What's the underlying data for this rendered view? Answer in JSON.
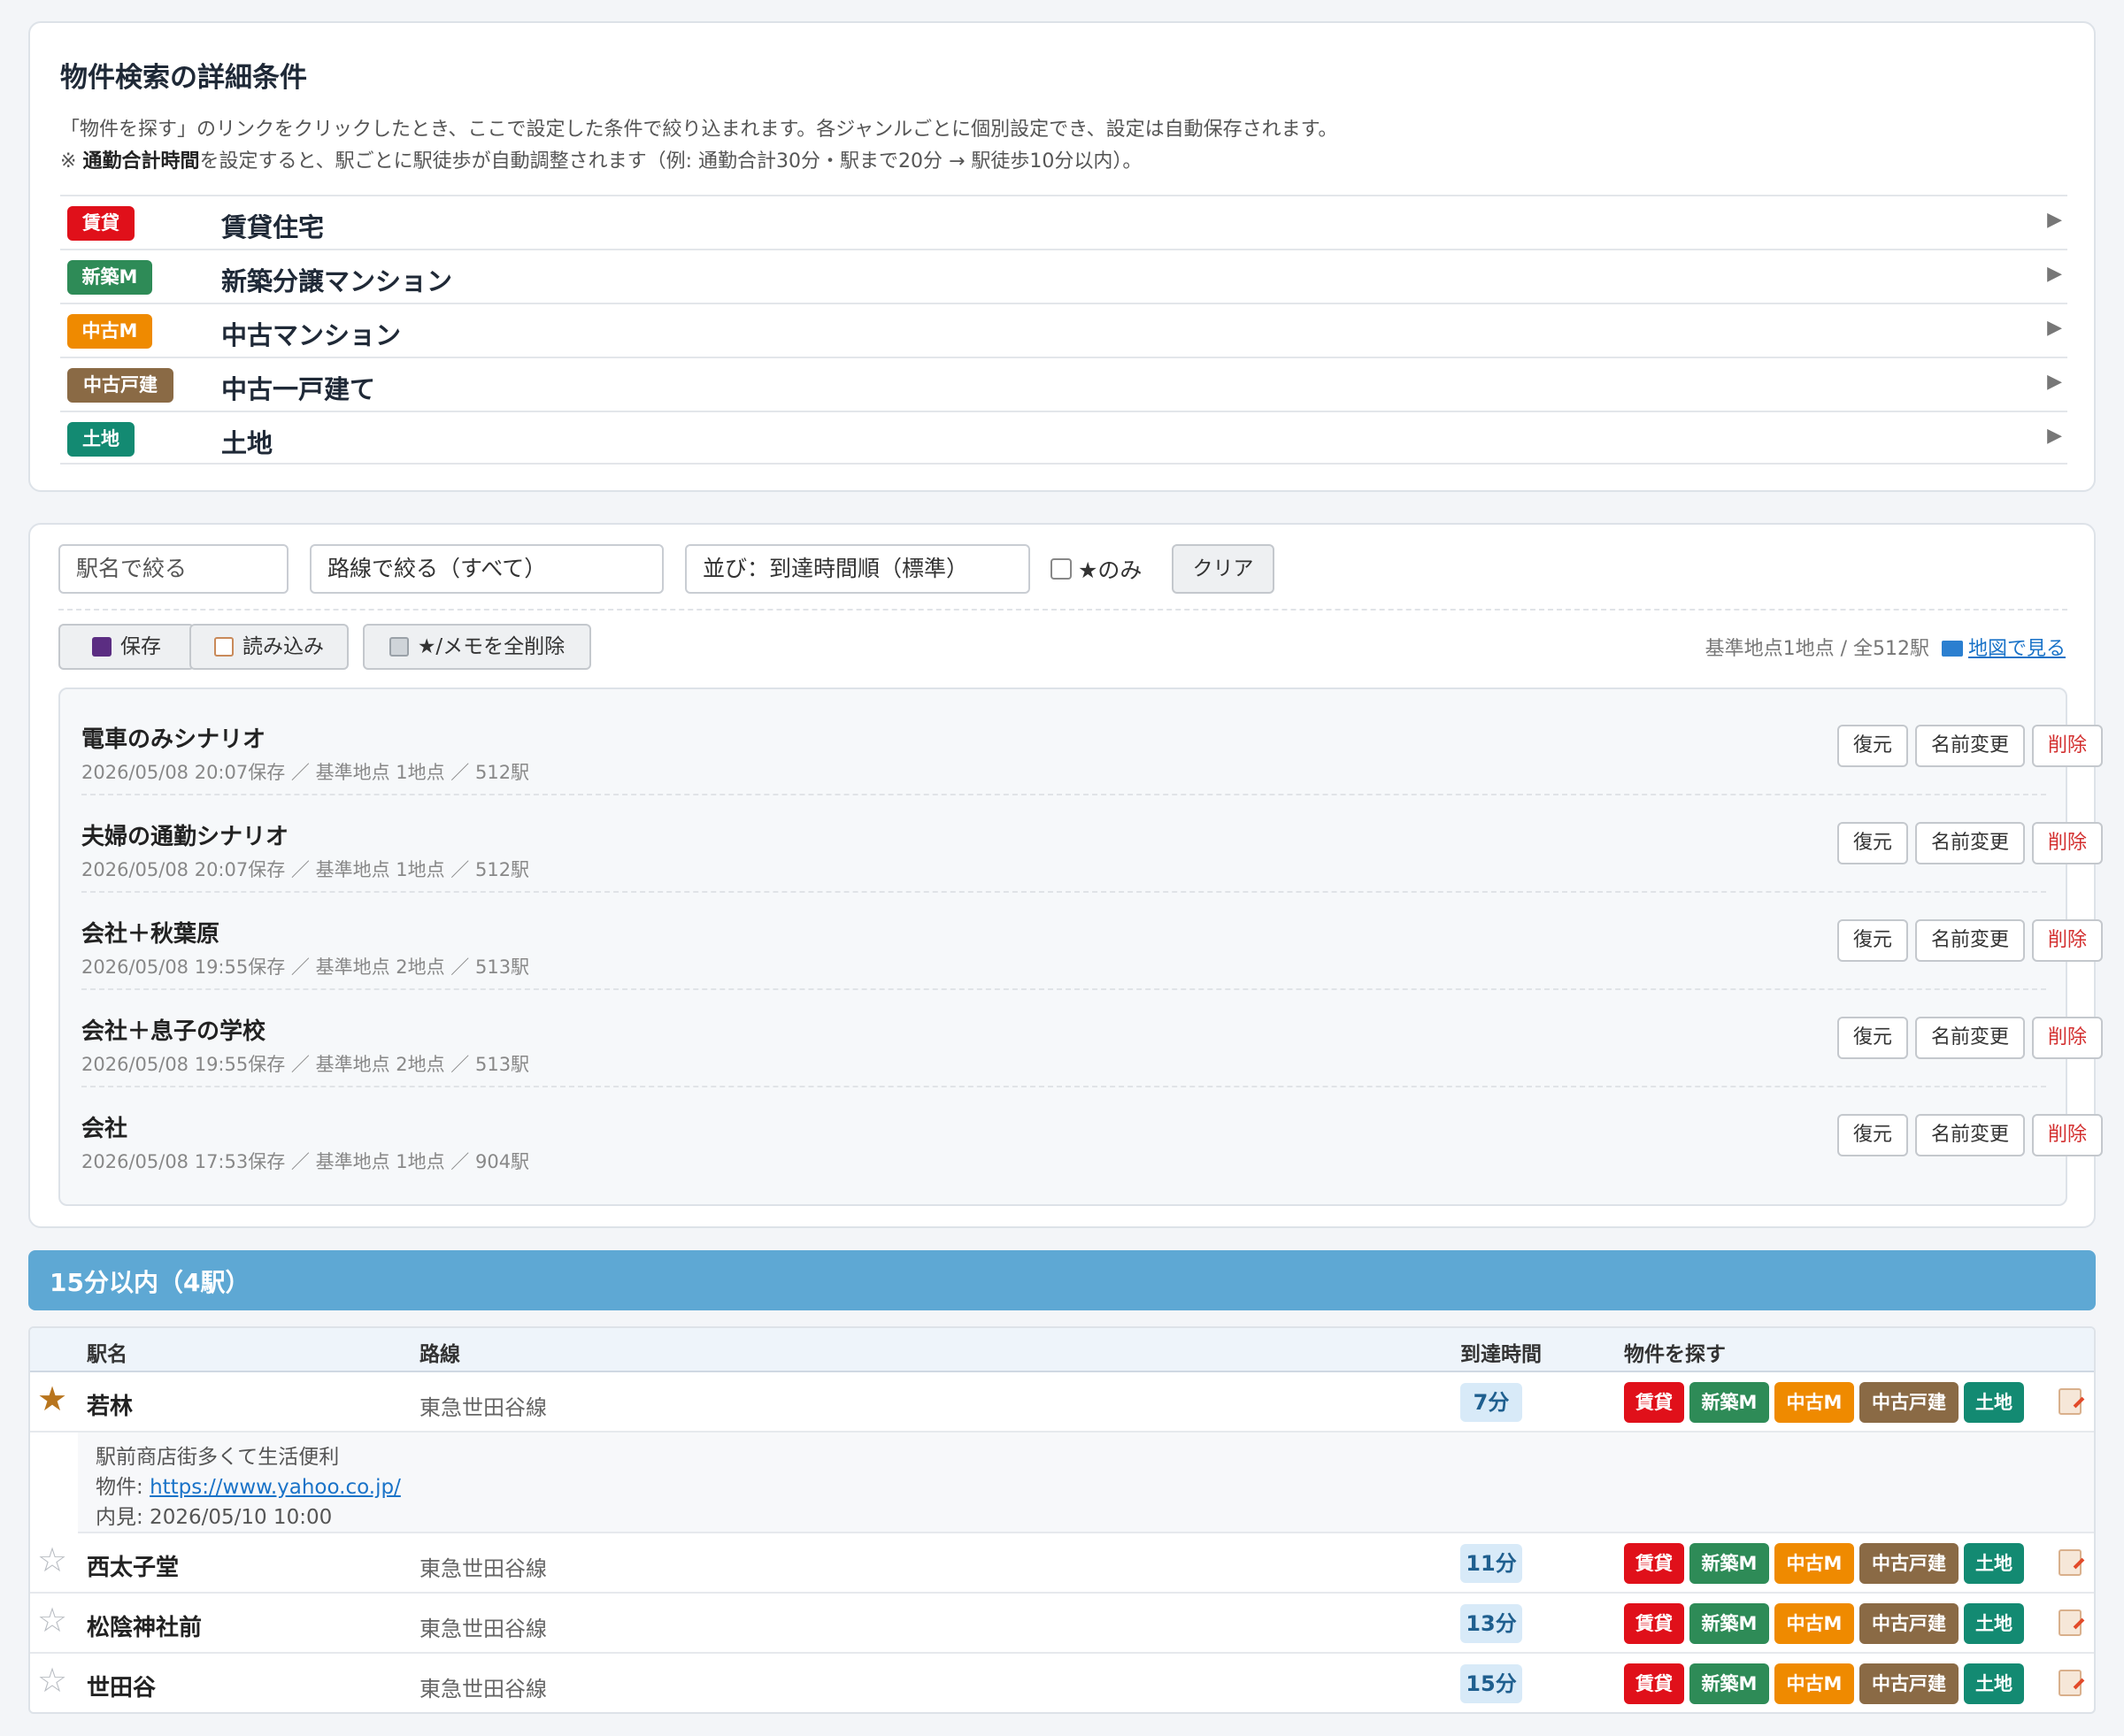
{
  "conditions": {
    "title": "物件検索の詳細条件",
    "desc1": "「物件を探す」のリンクをクリックしたとき、ここで設定した条件で絞り込まれます。各ジャンルごとに個別設定でき、設定は自動保存されます。",
    "desc2_prefix": "※ ",
    "desc2_bold": "通勤合計時間",
    "desc2_rest": "を設定すると、駅ごとに駅徒歩が自動調整されます（例: 通勤合計30分・駅まで20分 → 駅徒歩10分以内）。",
    "genres": [
      {
        "badge": "賃貸",
        "name": "賃貸住宅",
        "color": "#e0101a"
      },
      {
        "badge": "新築M",
        "name": "新築分譲マンション",
        "color": "#2e8b57"
      },
      {
        "badge": "中古M",
        "name": "中古マンション",
        "color": "#ef8a00"
      },
      {
        "badge": "中古戸建",
        "name": "中古一戸建て",
        "color": "#8a6a45"
      },
      {
        "badge": "土地",
        "name": "土地",
        "color": "#138a72"
      }
    ],
    "arrow": "▶"
  },
  "toolbar": {
    "station_placeholder": "駅名で絞る",
    "line_select": "路線で絞る（すべて）",
    "sort_select": "並び：到達時間順（標準）",
    "star_only": "★のみ",
    "clear": "クリア",
    "save": "保存",
    "load": "読み込み",
    "delete_all": "★/メモを全削除",
    "info": "基準地点1地点 / 全512駅",
    "map_link": "地図で見る"
  },
  "scenarios": [
    {
      "name": "電車のみシナリオ",
      "meta": "2026/05/08 20:07保存 ／ 基準地点 1地点 ／ 512駅"
    },
    {
      "name": "夫婦の通勤シナリオ",
      "meta": "2026/05/08 20:07保存 ／ 基準地点 1地点 ／ 512駅"
    },
    {
      "name": "会社＋秋葉原",
      "meta": "2026/05/08 19:55保存 ／ 基準地点 2地点 ／ 513駅"
    },
    {
      "name": "会社＋息子の学校",
      "meta": "2026/05/08 19:55保存 ／ 基準地点 2地点 ／ 513駅"
    },
    {
      "name": "会社",
      "meta": "2026/05/08 17:53保存 ／ 基準地点 1地点 ／ 904駅"
    }
  ],
  "scenario_buttons": {
    "restore": "復元",
    "rename": "名前変更",
    "delete": "削除"
  },
  "group": {
    "title": "15分以内（4駅）"
  },
  "table": {
    "headers": {
      "station": "駅名",
      "line": "路線",
      "time": "到達時間",
      "search": "物件を探す"
    },
    "property_links": [
      "賃貸",
      "新築M",
      "中古M",
      "中古戸建",
      "土地"
    ],
    "rows": [
      {
        "star": "★",
        "starred": true,
        "station": "若林",
        "line": "東急世田谷線",
        "time": "7分"
      },
      {
        "star": "☆",
        "starred": false,
        "station": "西太子堂",
        "line": "東急世田谷線",
        "time": "11分"
      },
      {
        "star": "☆",
        "starred": false,
        "station": "松陰神社前",
        "line": "東急世田谷線",
        "time": "13分"
      },
      {
        "star": "☆",
        "starred": false,
        "station": "世田谷",
        "line": "東急世田谷線",
        "time": "15分"
      }
    ],
    "note": {
      "text": "駅前商店街多くて生活便利",
      "property_label": "物件: ",
      "property_url": "https://www.yahoo.co.jp/",
      "visit": "内見: 2026/05/10 10:00"
    }
  }
}
